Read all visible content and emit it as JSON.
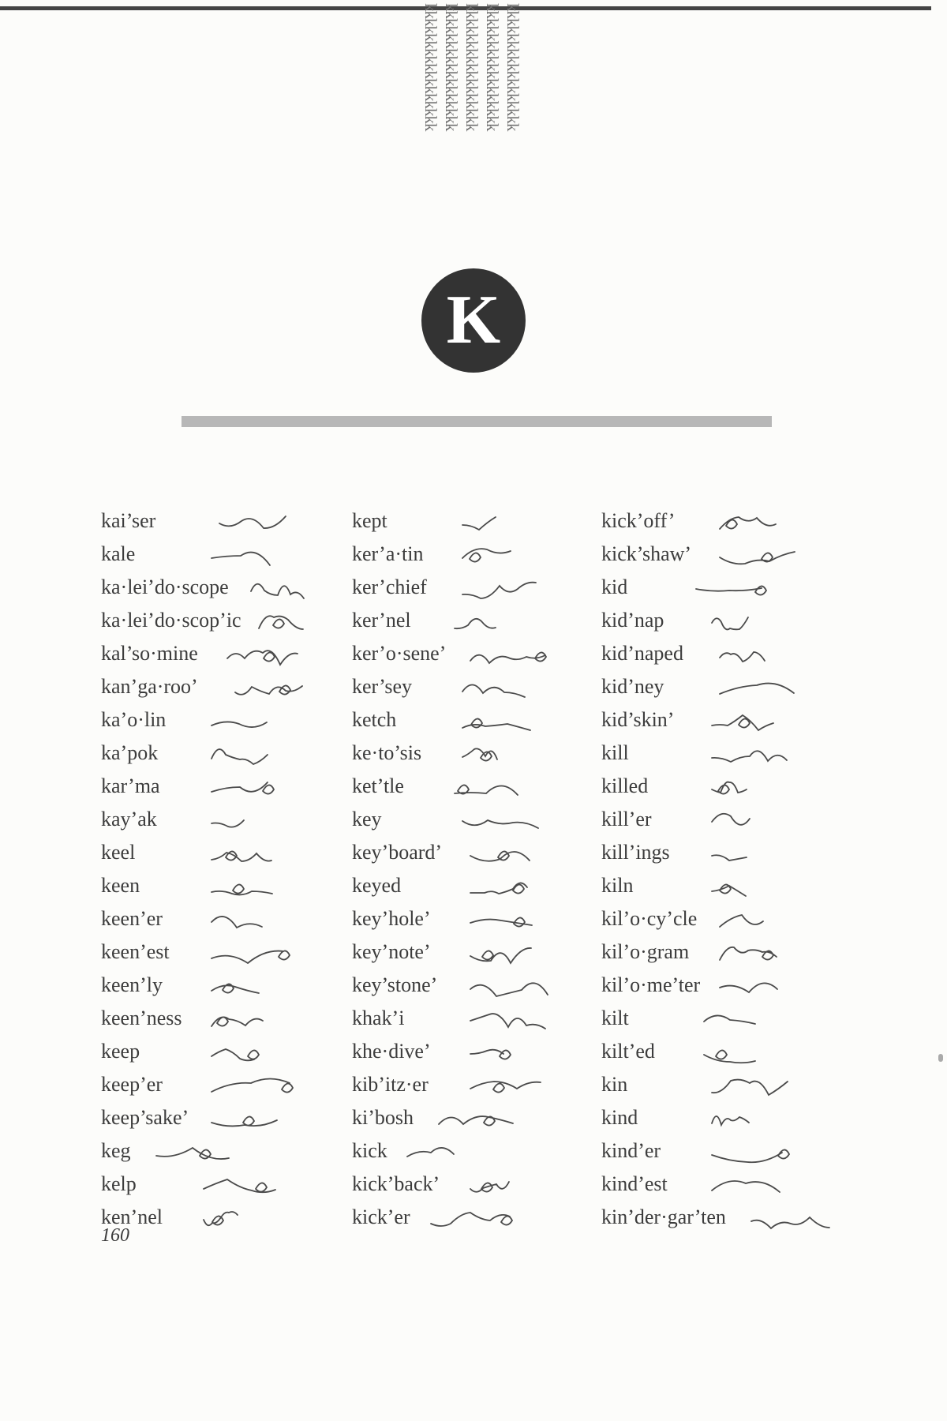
{
  "section_letter": "K",
  "pattern_letters": "kkkkkkkkkkkkkkkkk",
  "page_number": "160",
  "columns": [
    {
      "entries": [
        {
          "word": "kai’ser"
        },
        {
          "word": "kale"
        },
        {
          "word": "ka·lei’do·scope"
        },
        {
          "word": "ka·lei’do·scop’ic"
        },
        {
          "word": "kal’so·mine"
        },
        {
          "word": "kan’ga·roo’"
        },
        {
          "word": "ka’o·lin"
        },
        {
          "word": "ka’pok"
        },
        {
          "word": "kar’ma"
        },
        {
          "word": "kay’ak"
        },
        {
          "word": "keel"
        },
        {
          "word": "keen"
        },
        {
          "word": "keen’er"
        },
        {
          "word": "keen’est"
        },
        {
          "word": "keen’ly"
        },
        {
          "word": "keen’ness"
        },
        {
          "word": "keep"
        },
        {
          "word": "keep’er"
        },
        {
          "word": "keep’sake’"
        },
        {
          "word": "keg"
        },
        {
          "word": "kelp"
        },
        {
          "word": "ken’nel"
        }
      ]
    },
    {
      "entries": [
        {
          "word": "kept"
        },
        {
          "word": "ker’a·tin"
        },
        {
          "word": "ker’chief"
        },
        {
          "word": "ker’nel"
        },
        {
          "word": "ker’o·sene’"
        },
        {
          "word": "ker’sey"
        },
        {
          "word": "ketch"
        },
        {
          "word": "ke·to’sis"
        },
        {
          "word": "ket’tle"
        },
        {
          "word": "key"
        },
        {
          "word": "key’board’"
        },
        {
          "word": "keyed"
        },
        {
          "word": "key’hole’"
        },
        {
          "word": "key’note’"
        },
        {
          "word": "key’stone’"
        },
        {
          "word": "khak’i"
        },
        {
          "word": "khe·dive’"
        },
        {
          "word": "kib’itz·er"
        },
        {
          "word": "ki’bosh"
        },
        {
          "word": "kick"
        },
        {
          "word": "kick’back’"
        },
        {
          "word": "kick’er"
        }
      ]
    },
    {
      "entries": [
        {
          "word": "kick’off’"
        },
        {
          "word": "kick’shaw’"
        },
        {
          "word": "kid"
        },
        {
          "word": "kid’nap"
        },
        {
          "word": "kid’naped"
        },
        {
          "word": "kid’ney"
        },
        {
          "word": "kid’skin’"
        },
        {
          "word": "kill"
        },
        {
          "word": "killed"
        },
        {
          "word": "kill’er"
        },
        {
          "word": "kill’ings"
        },
        {
          "word": "kiln"
        },
        {
          "word": "kil’o·cy’cle"
        },
        {
          "word": "kil’o·gram"
        },
        {
          "word": "kil’o·me’ter"
        },
        {
          "word": "kilt"
        },
        {
          "word": "kilt’ed"
        },
        {
          "word": "kin"
        },
        {
          "word": "kind"
        },
        {
          "word": "kind’er"
        },
        {
          "word": "kind’est"
        },
        {
          "word": "kin’der·gar’ten"
        }
      ]
    }
  ]
}
